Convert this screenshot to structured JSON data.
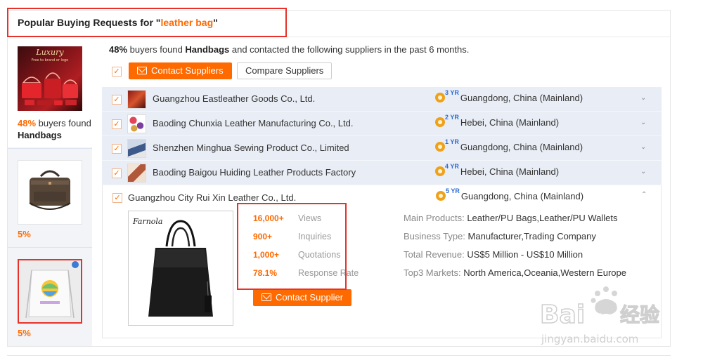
{
  "header": {
    "title_prefix": "Popular Buying Requests for \"",
    "keyword": "leather bag",
    "title_suffix": "\""
  },
  "left": {
    "tile1": {
      "percent": "48%",
      "found_text": " buyers found",
      "category": "Handbags",
      "thumb_text": "Luxury",
      "thumb_sub": "Free to brand or logo"
    },
    "tile2": {
      "percent": "5%"
    },
    "tile3": {
      "percent": "5%"
    }
  },
  "summary": {
    "percent": "48%",
    "text_a": " buyers found ",
    "category": "Handbags",
    "text_b": " and contacted the following suppliers in the past 6 months."
  },
  "actions": {
    "contact_suppliers": "Contact Suppliers",
    "compare_suppliers": "Compare Suppliers"
  },
  "suppliers": [
    {
      "name": "Guangzhou Eastleather Goods Co., Ltd.",
      "years": "3 YR",
      "location": "Guangdong, China (Mainland)"
    },
    {
      "name": "Baoding Chunxia Leather Manufacturing Co., Ltd.",
      "years": "2 YR",
      "location": "Hebei, China (Mainland)"
    },
    {
      "name": "Shenzhen Minghua Sewing Product Co., Limited",
      "years": "1 YR",
      "location": "Guangdong, China (Mainland)"
    },
    {
      "name": "Baoding Baigou Huiding Leather Products Factory",
      "years": "4 YR",
      "location": "Hebei, China (Mainland)"
    }
  ],
  "expanded": {
    "name": "Guangzhou City Rui Xin Leather Co., Ltd.",
    "years": "5 YR",
    "location": "Guangdong, China (Mainland)",
    "brand_script": "Farnola",
    "stats": [
      {
        "value": "16,000+",
        "label": "Views"
      },
      {
        "value": "900+",
        "label": "Inquiries"
      },
      {
        "value": "1,000+",
        "label": "Quotations"
      },
      {
        "value": "78.1%",
        "label": "Response Rate"
      }
    ],
    "details": [
      {
        "key": "Main Products: ",
        "value": "Leather/PU Bags,Leather/PU Wallets"
      },
      {
        "key": "Business Type: ",
        "value": "Manufacturer,Trading Company"
      },
      {
        "key": "Total Revenue: ",
        "value": "US$5 Million - US$10 Million"
      },
      {
        "key": "Top3 Markets: ",
        "value": "North America,Oceania,Western Europe"
      }
    ],
    "contact_button": "Contact Supplier"
  },
  "watermark": {
    "brand": "Bai",
    "brand2": "du",
    "cn": "经验",
    "url": "jingyan.baidu.com"
  },
  "colors": {
    "accent": "#ff6a00",
    "highlight": "#e8312b",
    "row_bg": "#e9edf5",
    "badge": "#f0a11a",
    "years": "#2d6cd2"
  }
}
